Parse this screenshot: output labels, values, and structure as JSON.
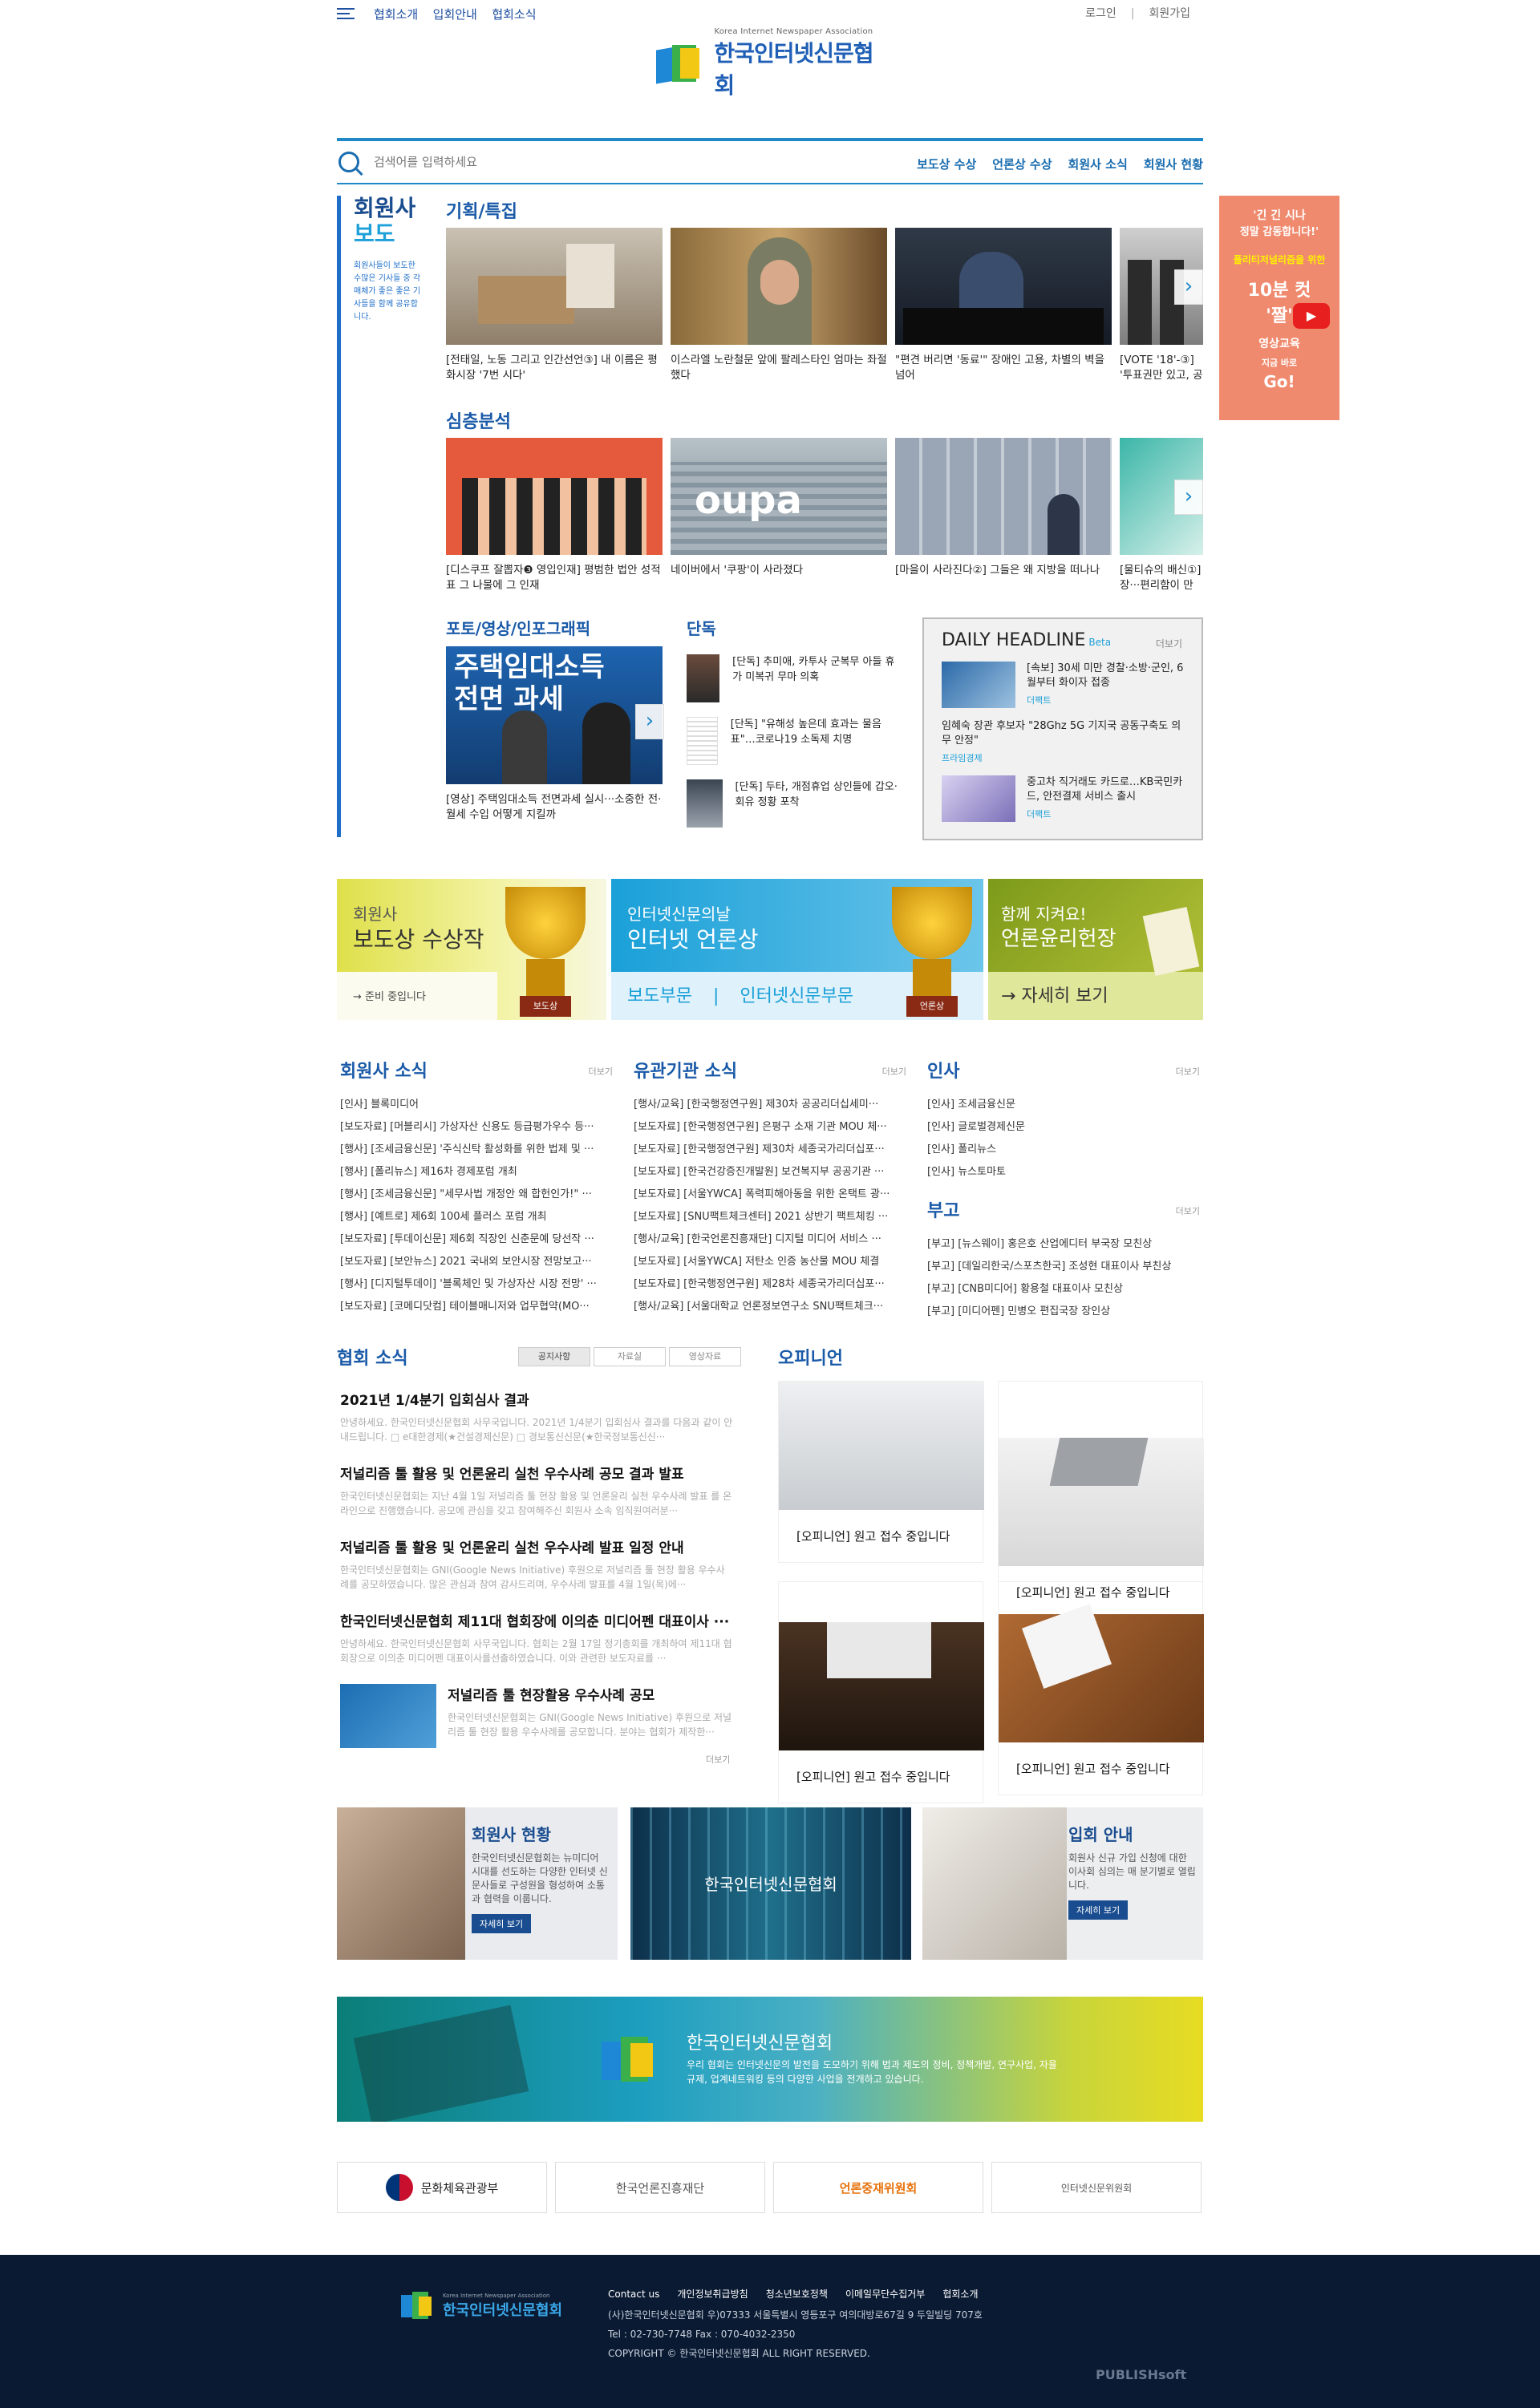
{
  "topnav": {
    "items": [
      "협회소개",
      "입회안내",
      "협회소식"
    ],
    "login": "로그인",
    "join": "회원가입"
  },
  "logo": {
    "en": "Korea Internet Newspaper Association",
    "ko": "한국인터넷신문협회"
  },
  "search": {
    "placeholder": "검색어를 입력하세요",
    "quick": [
      "보도상 수상",
      "언론상 수상",
      "회원사 소식",
      "회원사 현황"
    ]
  },
  "member_news": {
    "title1": "회원사",
    "title2": "보도",
    "desc": "회원사들이 보도한 수많은 기사들 중 각 매체가 좋은 좋은 기사들을 함께 공유합니다."
  },
  "special": {
    "title": "기획/특집",
    "items": [
      "[전태일, 노동 그리고 인간선언③] 내 이름은 평화시장 '7번 시다'",
      "이스라엘 노란철문 앞에 팔레스타인 엄마는 좌절했다",
      "\"편견 버리면 '동료'\" 장애인 고용, 차별의 벽을 넘어",
      "[VOTE '18'-③] '투표권만 있고, 공"
    ]
  },
  "depth": {
    "title": "심층분석",
    "items": [
      "[디스쿠프 잘뽑자❸ 영입인재] 평범한 법안 성적표 그 나물에 그 인재",
      "네이버에서 '쿠팡'이 사라졌다",
      "[마을이 사라진다②] 그들은 왜 지방을 떠나나",
      "[물티슈의 배신①] 장···편리함이 만든"
    ]
  },
  "photo": {
    "title": "포토/영상/인포그래픽",
    "caption": "[영상] 주택임대소득 전면과세 실시···소중한 전·월세 수입 어떻게 지킬까",
    "thumb_text": "주택임대소득 전면 과세"
  },
  "exclusive": {
    "title": "단독",
    "items": [
      "[단독] 추미애, 카투사 군복무 아들 휴가 미복귀 무마 의혹",
      "[단독] \"유해성 높은데 효과는 물음표\"…코로나19 소독제 치명",
      "[단독] 두타, 개점휴업 상인들에 갑오·회유 정황 포착"
    ]
  },
  "daily": {
    "title": "DAILY HEADLINE",
    "beta": "Beta",
    "more": "더보기",
    "items": [
      {
        "t": "[속보] 30세 미만 경찰·소방·군인, 6월부터 화이자 접종",
        "s": "더팩트"
      },
      {
        "t": "임혜숙 장관 후보자 \"28Ghz 5G 기지국 공동구축도 의무 안정\"",
        "s": "프라임경제"
      },
      {
        "t": "중고차 직거래도 카드로…KB국민카드, 안전결제 서비스 출시",
        "s": "더팩트"
      }
    ]
  },
  "ad": {
    "l1": "'긴 긴 시나",
    "l2": "정말 감동합니다!'",
    "l3": "폴리티저널리즘을 위한",
    "l4": "10분 컷",
    "l5": "'짤'",
    "l6": "영상교육",
    "l7": "지금 바로",
    "l8": "Go!"
  },
  "banners": {
    "b1_small": "회원사",
    "b1_big": "보도상 수상작",
    "b1_sub": "준비 중입니다",
    "b1_badge": "보도상",
    "b2_small": "인터넷신문의날",
    "b2_big": "인터넷 언론상",
    "b2_sub1": "보도부문",
    "b2_sep": "|",
    "b2_sub2": "인터넷신문부문",
    "b2_badge": "언론상",
    "b3_small": "함께 지켜요!",
    "b3_big": "언론윤리헌장",
    "b3_sub": "자세히 보기"
  },
  "col1": {
    "title": "회원사 소식",
    "more": "더보기",
    "items": [
      "[인사] 블록미디어",
      "[보도자료] [머블리시] 가상자산 신용도 등급평가우수 등···",
      "[행사] [조세금융신문] '주식신탁 활성화를 위한 법제 및 ···",
      "[행사] [폴리뉴스] 제16차 경제포럼 개최",
      "[행사] [조세금융신문] \"세무사법 개정안 왜 합헌인가!\" ···",
      "[행사] [예트로] 제6회 100세 플러스 포럼 개최",
      "[보도자료] [투데이신문] 제6회 직장인 신춘문예 당선작 ···",
      "[보도자료] [보안뉴스] 2021 국내외 보안시장 전망보고···",
      "[행사] [디지털투데이] '블록체인 및 가상자산 시장 전망' ···",
      "[보도자료] [코메디닷컴] 테이블매니저와 업무협약(MO···"
    ]
  },
  "col2": {
    "title": "유관기관 소식",
    "more": "더보기",
    "items": [
      "[행사/교육] [한국행정연구원] 제30차 공공리더십세미···",
      "[보도자료] [한국행정연구원] 은평구 소재 기관 MOU 체···",
      "[보도자료] [한국행정연구원] 제30차 세종국가리더십포···",
      "[보도자료] [한국건강증진개발원] 보건복지부 공공기관 ···",
      "[보도자료] [서울YWCA] 폭력피해아동을 위한 온택트 광···",
      "[보도자료] [SNU팩트체크센터] 2021 상반기 팩트체킹 ···",
      "[행사/교육] [한국언론진흥재단] 디지털 미디어 서비스 ···",
      "[보도자료] [서울YWCA] 저탄소 인증 농산물 MOU 체결",
      "[보도자료] [한국행정연구원] 제28차 세종국가리더십포···",
      "[행사/교육] [서울대학교 언론정보연구소 SNU팩트체크···"
    ]
  },
  "col3": {
    "title": "인사",
    "more": "더보기",
    "items": [
      "[인사] 조세금융신문",
      "[인사] 글로벌경제신문",
      "[인사] 폴리뉴스",
      "[인사] 뉴스토마토"
    ],
    "title2": "부고",
    "more2": "더보기",
    "items2": [
      "[부고] [뉴스웨이] 홍은호 산업에디터 부국장 모친상",
      "[부고] [데일리한국/스포츠한국] 조성현 대표이사 부친상",
      "[부고] [CNB미디어] 황용철 대표이사 모친상",
      "[부고] [미디어펜] 민병오 편집국장 장인상"
    ]
  },
  "notice": {
    "title": "협회 소식",
    "tabs": [
      "공지사항",
      "자료실",
      "영상자료"
    ],
    "more": "더보기",
    "items": [
      {
        "t": "2021년 1/4분기 입회심사 결과",
        "d": "안녕하세요. 한국인터넷신문협회 사무국입니다. 2021년 1/4분기 입회심사 결과를 다음과 같이 안내드립니다. □ e대한경제(★건설경제신문) □ 경보통신신문(★한국정보통신신···"
      },
      {
        "t": "저널리즘 툴 활용 및 언론윤리 실천 우수사례 공모 결과 발표",
        "d": "한국인터넷신문협회는 지난 4월 1일 저널리즘 툴 현장 활용 및 언론윤리 실천 우수사례 발표 를 온라인으로 진행했습니다. 공모에 관심을 갖고 참여해주신 회원사 소속 임직원여러분···"
      },
      {
        "t": "저널리즘 툴 활용 및 언론윤리 실천 우수사례 발표 일정 안내",
        "d": "한국인터넷신문협회는 GNI(Google News Initiative) 후원으로 저널리즘 툴 현장 활용 우수사례를 공모하였습니다. 많은 관심과 참여 감사드리며, 우수사례 발표를 4월 1일(목)에···"
      },
      {
        "t": "한국인터넷신문협회 제11대 협회장에 이의춘 미디어펜 대표이사 ···",
        "d": "안녕하세요. 한국인터넷신문협회 사무국입니다. 협회는 2월 17일 정기총회를 개최하여 제11대 협회장으로 이의춘 미디어펜 대표이사를선출하였습니다. 이와 관련한 보도자료를 ···"
      },
      {
        "t": "저널리즘 툴 현장활용 우수사례 공모",
        "d": "한국인터넷신문협회는 GNI(Google News Initiative) 후원으로 저널리즘 툴 현장 활용 우수사례를 공모합니다. 분야는 협회가 제작한···"
      }
    ]
  },
  "opinion": {
    "title": "오피니언",
    "items": [
      "[오피니언] 원고 접수 중입니다",
      "[오피니언] 원고 접수 중입니다",
      "[오피니언] 원고 접수 중입니다",
      "[오피니언] 원고 접수 중입니다"
    ]
  },
  "info": {
    "m_title": "회원사 현황",
    "m_desc": "한국인터넷신문협회는 뉴미디어 시대를 선도하는 다양한 인터넷 신문사들로 구성원을 형성하여 소통과 협력을 이룹니다.",
    "m_btn": "자세히 보기",
    "c_text": "한국인터넷신문협회",
    "j_title": "입회 안내",
    "j_desc": "회원사 신규 가입 신청에 대한 이사회 심의는 매 분기별로 열립니다.",
    "j_btn": "자세히 보기"
  },
  "big": {
    "title": "한국인터넷신문협회",
    "desc": "우리 협회는 인터넷신문의 발전을 도모하기 위해 법과 제도의 정비, 정책개발, 연구사업, 자율규제, 업계네트워킹 등의 다양한 사업을 전개하고 있습니다."
  },
  "partners": [
    "문화체육관광부",
    "한국언론진흥재단",
    "언론중재위원회",
    "인터넷신문위원회"
  ],
  "footer": {
    "links": [
      "Contact us",
      "개인정보취급방침",
      "청소년보호정책",
      "이메일무단수집거부",
      "협회소개"
    ],
    "addr": "(사)한국인터넷신문협회 우)07333 서울특별시 영등포구 여의대방로67길 9 두일빌딩 707호",
    "tel": "Tel : 02-730-7748 Fax : 070-4032-2350",
    "copy": "COPYRIGHT © 한국인터넷신문협회 ALL RIGHT RESERVED.",
    "brand": "PUBLISHsoft"
  }
}
